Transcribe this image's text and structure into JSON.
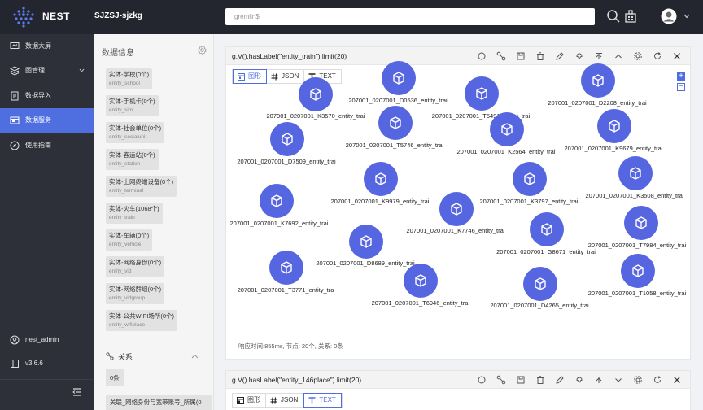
{
  "header": {
    "brand": "NEST",
    "project": "SJZSJ-sjzkg",
    "search_placeholder": "gremlin$"
  },
  "sidebar": {
    "items": [
      {
        "label": "数据大屏",
        "icon": "monitor-icon"
      },
      {
        "label": "图管理",
        "icon": "layers-icon"
      },
      {
        "label": "数据导入",
        "icon": "import-icon"
      },
      {
        "label": "数据服务",
        "icon": "service-icon",
        "active": true
      },
      {
        "label": "使用指南",
        "icon": "guide-icon"
      }
    ],
    "user": "nest_admin",
    "version": "v3.6.6"
  },
  "info": {
    "title": "数据信息",
    "entities": [
      {
        "name": "实体-学校(0个)",
        "code": "entity_school"
      },
      {
        "name": "实体-手机卡(0个)",
        "code": "entity_sim"
      },
      {
        "name": "实体-社会单位(0个)",
        "code": "entity_socialunit"
      },
      {
        "name": "实体-客运站(0个)",
        "code": "entity_station"
      },
      {
        "name": "实体-上网终端设备(0个)",
        "code": "entity_terminal"
      },
      {
        "name": "实体-火车(1068个)",
        "code": "entity_train"
      },
      {
        "name": "实体-车辆(0个)",
        "code": "entity_vehicle"
      },
      {
        "name": "实体-网络身份(0个)",
        "code": "entity_vid"
      },
      {
        "name": "实体-网络群组(0个)",
        "code": "entity_vidgroup"
      },
      {
        "name": "实体-公共WIFI场所(0个)",
        "code": "entity_wifiplace"
      }
    ],
    "relations_title": "关系",
    "relations_count": "0条",
    "relation_item": "关联_网络身份与宽带账号_所属(0"
  },
  "panel1": {
    "query": "g.V().hasLabel(\"entity_train\").limit(20)",
    "tabs": [
      "图形",
      "JSON",
      "TEXT"
    ],
    "nodes": [
      "207001_0207001_D0536_entity_trai",
      "207001_0207001_D2208_entity_trai",
      "207001_0207001_K3570_entity_trai",
      "207001_0207001_T5491_entity_trai",
      "207001_0207001_T5746_entity_trai",
      "207001_0207001_K2564_entity_trai",
      "207001_0207001_K9679_entity_trai",
      "207001_0207001_D7509_entity_trai",
      "207001_0207001_K9979_entity_trai",
      "207001_0207001_K3797_entity_trai",
      "207001_0207001_K3508_entity_trai",
      "207001_0207001_K7692_entity_trai",
      "207001_0207001_K7746_entity_trai",
      "207001_0207001_G8671_entity_trai",
      "207001_0207001_D8689_entity_trai",
      "207001_0207001_T7984_entity_trai",
      "207001_0207001_T3771_entity_tra",
      "207001_0207001_T6946_entity_tra",
      "207001_0207001_D4265_entity_trai",
      "207001_0207001_T1058_entity_trai"
    ],
    "status": "响应时间:855ms, 节点: 20个, 关系: 0条"
  },
  "panel2": {
    "query": "g.V().hasLabel(\"entity_146place\").limit(20)",
    "tabs": [
      "图形",
      "JSON",
      "TEXT"
    ]
  },
  "colors": {
    "accent": "#4f6ee0",
    "node": "#5566e0",
    "sidebar": "#2d3039",
    "topbar": "#23262e"
  }
}
